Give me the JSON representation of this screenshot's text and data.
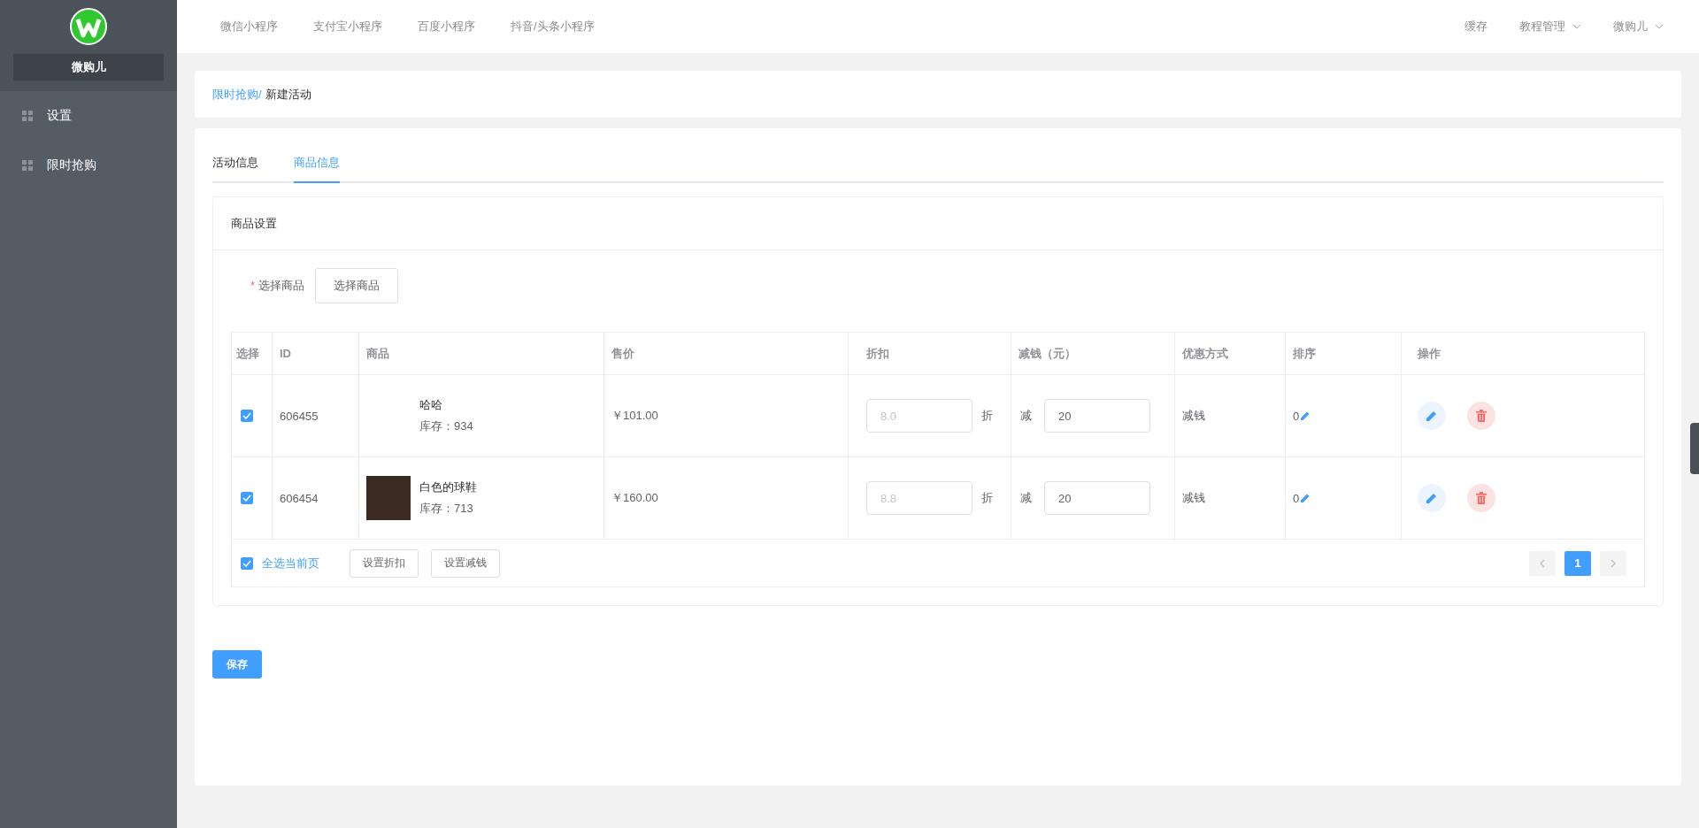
{
  "sidebar": {
    "brand": "微购儿",
    "items": [
      {
        "label": "设置",
        "selected": false
      },
      {
        "label": "限时抢购",
        "selected": false
      }
    ]
  },
  "topnav": {
    "items": [
      {
        "label": "微信小程序"
      },
      {
        "label": "支付宝小程序"
      },
      {
        "label": "百度小程序"
      },
      {
        "label": "抖音/头条小程序"
      }
    ],
    "right": [
      {
        "label": "缓存",
        "dropdown": false
      },
      {
        "label": "教程管理",
        "dropdown": true
      },
      {
        "label": "微购儿",
        "dropdown": true
      }
    ]
  },
  "breadcrumb": {
    "link": "限时抢购/",
    "current": "新建活动"
  },
  "tabs": [
    {
      "label": "活动信息",
      "selected": false
    },
    {
      "label": "商品信息",
      "selected": true
    }
  ],
  "card": {
    "title": "商品设置",
    "field_label": "选择商品",
    "required_mark": "*",
    "button": "选择商品"
  },
  "table": {
    "columns": [
      "选择",
      "ID",
      "商品",
      "售价",
      "折扣",
      "减钱（元）",
      "优惠方式",
      "排序",
      "操作"
    ],
    "rows": [
      {
        "checked": true,
        "id": "606455",
        "has_photo": false,
        "name": "哈哈",
        "stock": "库存：934",
        "price": "￥101.00",
        "discount_placeholder": "8.0",
        "discount_unit": "折",
        "reduce_prefix": "减",
        "reduce": "20",
        "method": "减钱",
        "sort": "0"
      },
      {
        "checked": true,
        "id": "606454",
        "has_photo": true,
        "name": "白色的球鞋",
        "stock": "库存：713",
        "price": "￥160.00",
        "discount_placeholder": "8.8",
        "discount_unit": "折",
        "reduce_prefix": "减",
        "reduce": "20",
        "method": "减钱",
        "sort": "0"
      }
    ],
    "footer": {
      "select_all_checked": true,
      "select_all": "全选当前页",
      "buttons": [
        "设置折扣",
        "设置减钱"
      ]
    },
    "pages": [
      {
        "label": "1",
        "selected": true
      }
    ]
  },
  "save": "保存"
}
